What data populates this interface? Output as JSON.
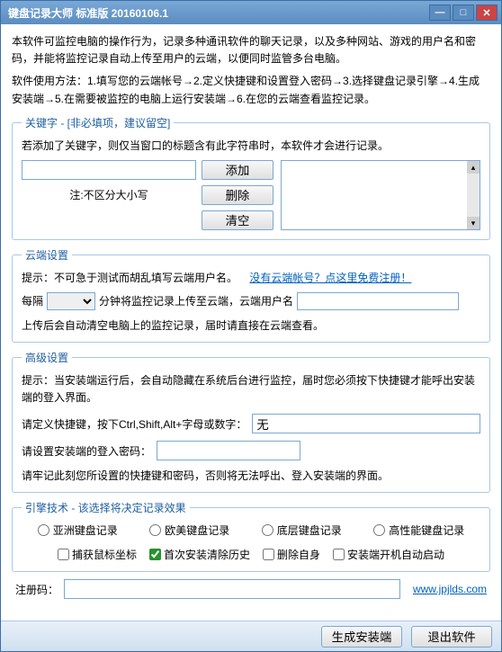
{
  "window": {
    "title": "键盘记录大师 标准版 20160106.1"
  },
  "intro": "本软件可监控电脑的操作行为，记录多种通讯软件的聊天记录，以及多种网站、游戏的用户名和密码，并能将监控记录自动上传至用户的云端，以便同时监管多台电脑。",
  "usage": "软件使用方法：1.填写您的云端帐号→2.定义快捷键和设置登入密码→3.选择键盘记录引擎→4.生成安装端→5.在需要被监控的电脑上运行安装端→6.在您的云端查看监控记录。",
  "keyword": {
    "legend": "关键字 - [非必填项，建议留空]",
    "hint": "若添加了关键字，则仅当窗口的标题含有此字符串时，本软件才会进行记录。",
    "add": "添加",
    "del": "删除",
    "clear": "清空",
    "note": "注:不区分大小写"
  },
  "cloud": {
    "legend": "云端设置",
    "hint_prefix": "提示：不可急于测试而胡乱填写云端用户名。",
    "no_account": "没有云端帐号？点这里免费注册！",
    "interval_prefix": "每隔",
    "interval_suffix": "分钟将监控记录上传至云端，云端用户名",
    "upload_note": "上传后会自动清空电脑上的监控记录，届时请直接在云端查看。"
  },
  "advanced": {
    "legend": "高级设置",
    "hint": "提示：当安装端运行后，会自动隐藏在系统后台进行监控，届时您必须按下快捷键才能呼出安装端的登入界面。",
    "hotkey_label": "请定义快捷键，按下Ctrl,Shift,Alt+字母或数字：",
    "hotkey_value": "无",
    "pw_label": "请设置安装端的登入密码：",
    "remember": "请牢记此刻您所设置的快捷键和密码，否则将无法呼出、登入安装端的界面。"
  },
  "engine": {
    "legend": "引擎技术 - 该选择将决定记录效果",
    "opts": [
      "亚洲键盘记录",
      "欧美键盘记录",
      "底层键盘记录",
      "高性能键盘记录"
    ],
    "chks": [
      {
        "label": "捕获鼠标坐标",
        "checked": false
      },
      {
        "label": "首次安装清除历史",
        "checked": true
      },
      {
        "label": "删除自身",
        "checked": false
      },
      {
        "label": "安装端开机自动启动",
        "checked": false
      }
    ]
  },
  "reg": {
    "label": "注册码：",
    "link": "www.jpjlds.com"
  },
  "footer": {
    "build": "生成安装端",
    "exit": "退出软件"
  }
}
